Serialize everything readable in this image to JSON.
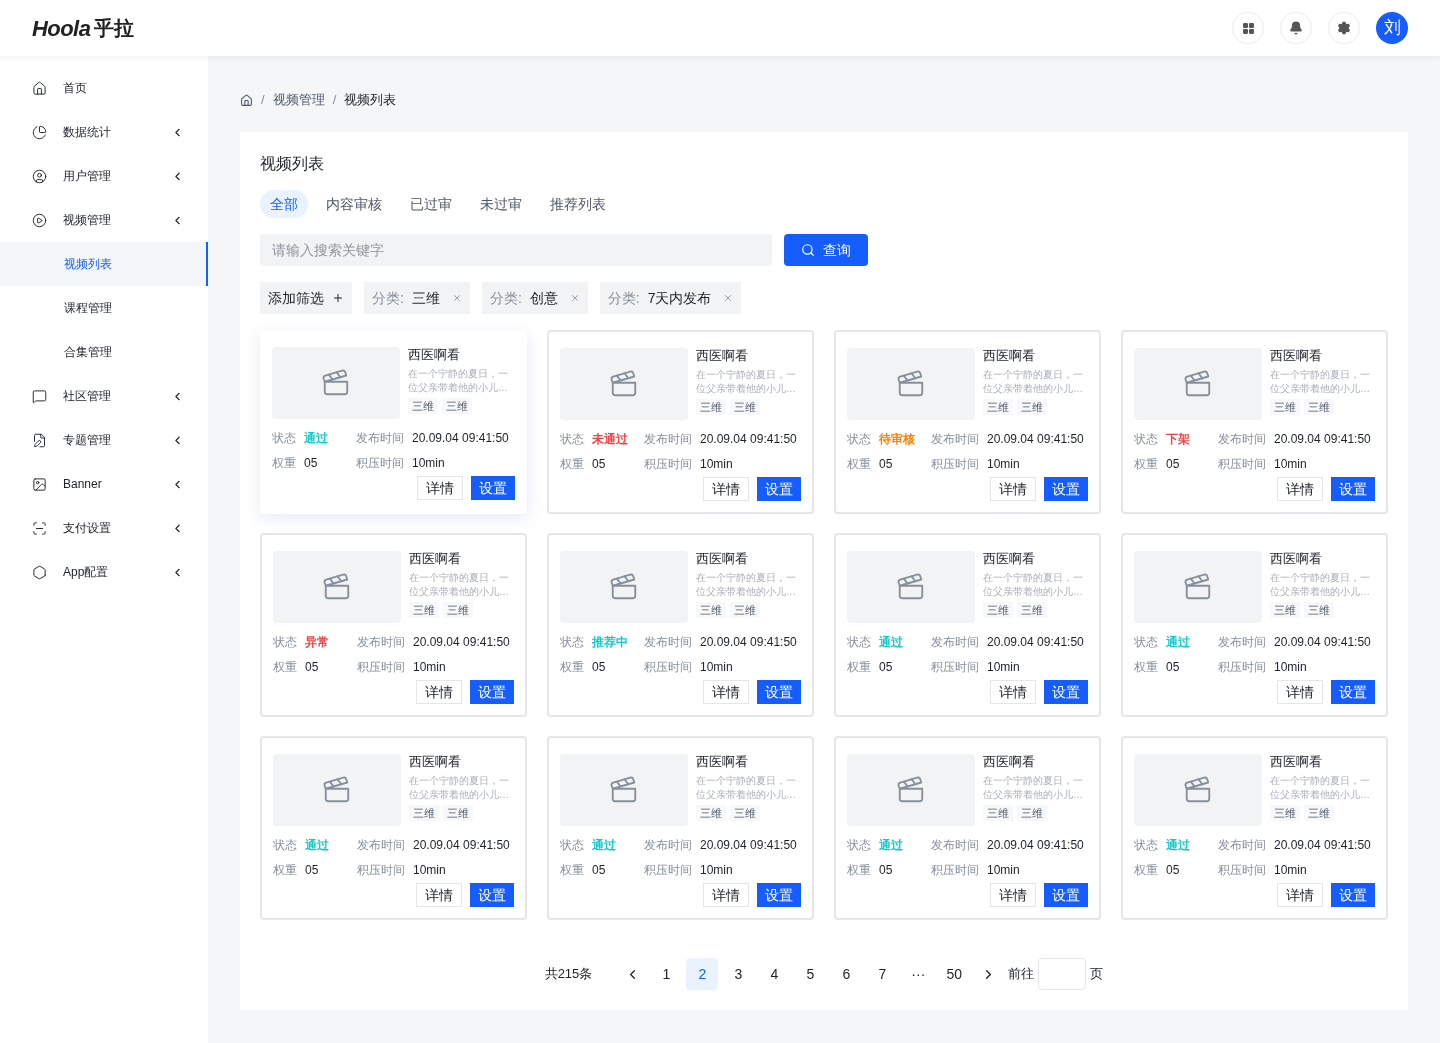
{
  "header": {
    "logo": "Hoola",
    "logo_cn": "乎拉",
    "avatar": "刘"
  },
  "sidebar": {
    "items": [
      {
        "label": "首页",
        "has_arrow": false,
        "selected": false
      },
      {
        "label": "数据统计",
        "has_arrow": true,
        "selected": false
      },
      {
        "label": "用户管理",
        "has_arrow": true,
        "selected": false
      },
      {
        "label": "视频管理",
        "has_arrow": true,
        "selected": false,
        "children": [
          {
            "label": "视频列表",
            "selected": true
          },
          {
            "label": "课程管理",
            "selected": false
          },
          {
            "label": "合集管理",
            "selected": false
          }
        ]
      },
      {
        "label": "社区管理",
        "has_arrow": true,
        "selected": false
      },
      {
        "label": "专题管理",
        "has_arrow": true,
        "selected": false
      },
      {
        "label": "Banner",
        "has_arrow": true,
        "selected": false
      },
      {
        "label": "支付设置",
        "has_arrow": true,
        "selected": false
      },
      {
        "label": "App配置",
        "has_arrow": true,
        "selected": false
      }
    ]
  },
  "breadcrumb": [
    {
      "separator": "/",
      "label": "视频管理"
    },
    {
      "separator": "/",
      "label": "视频列表"
    }
  ],
  "panel": {
    "title": "视频列表",
    "tabs": [
      {
        "label": "全部",
        "selected": true
      },
      {
        "label": "内容审核",
        "selected": false
      },
      {
        "label": "已过审",
        "selected": false
      },
      {
        "label": "未过审",
        "selected": false
      },
      {
        "label": "推荐列表",
        "selected": false
      }
    ],
    "search": {
      "placeholder": "请输入搜索关键字",
      "button": "查询"
    },
    "add_filter": "添加筛选",
    "filters": [
      {
        "label": "分类:",
        "value": "三维"
      },
      {
        "label": "分类:",
        "value": "创意"
      },
      {
        "label": "分类:",
        "value": "7天内发布"
      }
    ],
    "cards": [
      {
        "title": "西医啊看",
        "description": "在一个宁静的夏日，一位父亲带着他的小儿…",
        "tags": [
          "三维",
          "三维"
        ],
        "status": "通过",
        "color": "#14c9c9",
        "time": "20.09.04 09:41:50",
        "weight": "05",
        "backlog": "10min",
        "hovered": true
      },
      {
        "title": "西医啊看",
        "description": "在一个宁静的夏日，一位父亲带着他的小儿…",
        "tags": [
          "三维",
          "三维"
        ],
        "status": "未通过",
        "color": "#f53f3f",
        "time": "20.09.04 09:41:50",
        "weight": "05",
        "backlog": "10min",
        "hovered": false
      },
      {
        "title": "西医啊看",
        "description": "在一个宁静的夏日，一位父亲带着他的小儿…",
        "tags": [
          "三维",
          "三维"
        ],
        "status": "待审核",
        "color": "#ff7d00",
        "time": "20.09.04 09:41:50",
        "weight": "05",
        "backlog": "10min",
        "hovered": false
      },
      {
        "title": "西医啊看",
        "description": "在一个宁静的夏日，一位父亲带着他的小儿…",
        "tags": [
          "三维",
          "三维"
        ],
        "status": "下架",
        "color": "#f53f3f",
        "time": "20.09.04 09:41:50",
        "weight": "05",
        "backlog": "10min",
        "hovered": false
      },
      {
        "title": "西医啊看",
        "description": "在一个宁静的夏日，一位父亲带着他的小儿…",
        "tags": [
          "三维",
          "三维"
        ],
        "status": "异常",
        "color": "#f53f3f",
        "time": "20.09.04 09:41:50",
        "weight": "05",
        "backlog": "10min",
        "hovered": false
      },
      {
        "title": "西医啊看",
        "description": "在一个宁静的夏日，一位父亲带着他的小儿…",
        "tags": [
          "三维",
          "三维"
        ],
        "status": "推荐中",
        "color": "#14c9c9",
        "time": "20.09.04 09:41:50",
        "weight": "05",
        "backlog": "10min",
        "hovered": false
      },
      {
        "title": "西医啊看",
        "description": "在一个宁静的夏日，一位父亲带着他的小儿…",
        "tags": [
          "三维",
          "三维"
        ],
        "status": "通过",
        "color": "#14c9c9",
        "time": "20.09.04 09:41:50",
        "weight": "05",
        "backlog": "10min",
        "hovered": false
      },
      {
        "title": "西医啊看",
        "description": "在一个宁静的夏日，一位父亲带着他的小儿…",
        "tags": [
          "三维",
          "三维"
        ],
        "status": "通过",
        "color": "#14c9c9",
        "time": "20.09.04 09:41:50",
        "weight": "05",
        "backlog": "10min",
        "hovered": false
      },
      {
        "title": "西医啊看",
        "description": "在一个宁静的夏日，一位父亲带着他的小儿…",
        "tags": [
          "三维",
          "三维"
        ],
        "status": "通过",
        "color": "#14c9c9",
        "time": "20.09.04 09:41:50",
        "weight": "05",
        "backlog": "10min",
        "hovered": false
      },
      {
        "title": "西医啊看",
        "description": "在一个宁静的夏日，一位父亲带着他的小儿…",
        "tags": [
          "三维",
          "三维"
        ],
        "status": "通过",
        "color": "#14c9c9",
        "time": "20.09.04 09:41:50",
        "weight": "05",
        "backlog": "10min",
        "hovered": false
      },
      {
        "title": "西医啊看",
        "description": "在一个宁静的夏日，一位父亲带着他的小儿…",
        "tags": [
          "三维",
          "三维"
        ],
        "status": "通过",
        "color": "#14c9c9",
        "time": "20.09.04 09:41:50",
        "weight": "05",
        "backlog": "10min",
        "hovered": false
      },
      {
        "title": "西医啊看",
        "description": "在一个宁静的夏日，一位父亲带着他的小儿…",
        "tags": [
          "三维",
          "三维"
        ],
        "status": "通过",
        "color": "#14c9c9",
        "time": "20.09.04 09:41:50",
        "weight": "05",
        "backlog": "10min",
        "hovered": false
      }
    ],
    "card_labels": [
      {
        "status": "状态",
        "time": "发布时间",
        "weight": "权重",
        "backlog": "积压时间",
        "detail": "详情",
        "settings": "设置"
      },
      {
        "status": "状态",
        "time": "发布时间",
        "weight": "权重",
        "backlog": "积压时间",
        "detail": "详情",
        "settings": "设置"
      },
      {
        "status": "状态",
        "time": "发布时间",
        "weight": "权重",
        "backlog": "积压时间",
        "detail": "详情",
        "settings": "设置"
      },
      {
        "status": "状态",
        "time": "发布时间",
        "weight": "权重",
        "backlog": "积压时间",
        "detail": "详情",
        "settings": "设置"
      },
      {
        "status": "状态",
        "time": "发布时间",
        "weight": "权重",
        "backlog": "积压时间",
        "detail": "详情",
        "settings": "设置"
      },
      {
        "status": "状态",
        "time": "发布时间",
        "weight": "权重",
        "backlog": "积压时间",
        "detail": "详情",
        "settings": "设置"
      },
      {
        "status": "状态",
        "time": "发布时间",
        "weight": "权重",
        "backlog": "积压时间",
        "detail": "详情",
        "settings": "设置"
      },
      {
        "status": "状态",
        "time": "发布时间",
        "weight": "权重",
        "backlog": "积压时间",
        "detail": "详情",
        "settings": "设置"
      },
      {
        "status": "状态",
        "time": "发布时间",
        "weight": "权重",
        "backlog": "积压时间",
        "detail": "详情",
        "settings": "设置"
      },
      {
        "status": "状态",
        "time": "发布时间",
        "weight": "权重",
        "backlog": "积压时间",
        "detail": "详情",
        "settings": "设置"
      },
      {
        "status": "状态",
        "time": "发布时间",
        "weight": "权重",
        "backlog": "积压时间",
        "detail": "详情",
        "settings": "设置"
      },
      {
        "status": "状态",
        "time": "发布时间",
        "weight": "权重",
        "backlog": "积压时间",
        "detail": "详情",
        "settings": "设置"
      }
    ]
  },
  "pagination": {
    "total": "共215条",
    "pages": [
      {
        "label": "1",
        "selected": false
      },
      {
        "label": "2",
        "selected": true
      },
      {
        "label": "3",
        "selected": false
      },
      {
        "label": "4",
        "selected": false
      },
      {
        "label": "5",
        "selected": false
      },
      {
        "label": "6",
        "selected": false
      },
      {
        "label": "7",
        "selected": false
      },
      {
        "label": "···",
        "selected": false
      },
      {
        "label": "50",
        "selected": false
      }
    ],
    "goto": "前往",
    "unit": "页"
  }
}
